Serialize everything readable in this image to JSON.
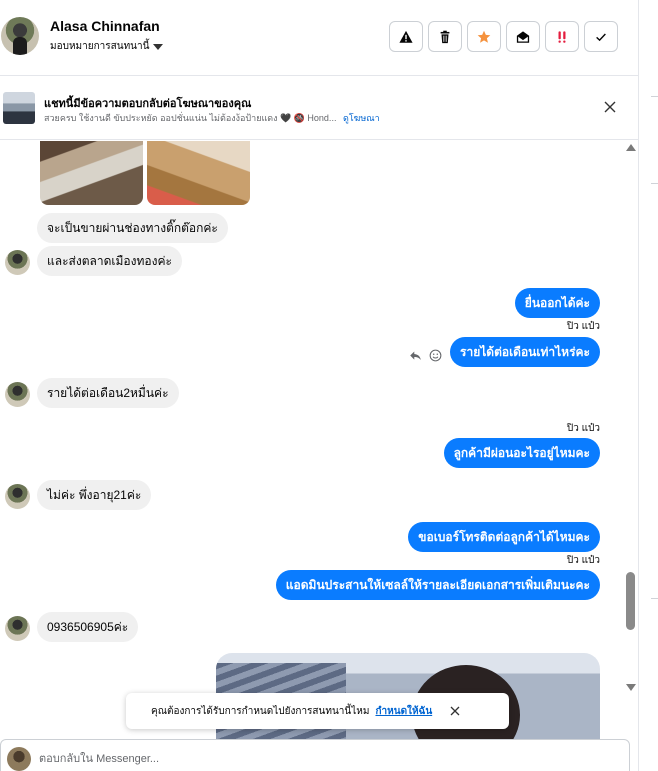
{
  "header": {
    "contact_name": "Alasa Chinnafan",
    "assign_label": "มอบหมายการสนทนานี้"
  },
  "actions": [
    {
      "name": "report-spam-button",
      "icon": "warning-triangle-icon",
      "color": "#050505"
    },
    {
      "name": "delete-button",
      "icon": "trash-icon",
      "color": "#050505"
    },
    {
      "name": "star-button",
      "icon": "star-icon",
      "color": "#f5923e"
    },
    {
      "name": "mark-unread-button",
      "icon": "envelope-open-icon",
      "color": "#050505"
    },
    {
      "name": "follow-up-button",
      "icon": "double-exclamation-icon",
      "color": "#e41e3f"
    },
    {
      "name": "mark-done-button",
      "icon": "check-icon",
      "color": "#050505"
    }
  ],
  "ad_banner": {
    "title": "แชทนี้มีข้อความตอบกลับต่อโฆษณาของคุณ",
    "subtitle": "สวยครบ ใช้งานดี ขับประหยัด ออปชั่นแน่น ไม่ต้องง้อป้ายแดง 🖤 🚳 Hond...",
    "link": "ดูโฆษณา"
  },
  "messages": {
    "m1": "จะเป็นขายผ่านช่องทางติ๊กต๊อกค่ะ",
    "m2": "และส่งตลาดเมืองทองค่ะ",
    "m3": "ยื่นออกได้ค่ะ",
    "m4": "รายได้ต่อเดือนเท่าไหร่คะ",
    "m5": "รายได้ต่อเดือน2หมื่นค่ะ",
    "m6": "ลูกค้ามีผ่อนอะไรอยู่ไหมคะ",
    "m7": "ไม่ค่ะ พึ่งอายุ21ค่ะ",
    "m8": "ขอเบอร์โทรติดต่อลูกค้าได้ไหมคะ",
    "m9": "แอดมินประสานให้เซลล์ให้รายละเอียดเอกสารเพิ่มเติมนะคะ",
    "m10": "0936506905ค่ะ",
    "seen_label": "ปิว แป๋ว"
  },
  "toast": {
    "text": "คุณต้องการได้รับการกำหนดไปยังการสนทนานี้ไหม",
    "link": "กำหนดให้ฉัน"
  },
  "composer": {
    "placeholder": "ตอบกลับใน Messenger..."
  },
  "colors": {
    "outgoing_bubble": "#0a7cff",
    "incoming_bubble": "#f0f0f0",
    "link": "#0064d1"
  }
}
